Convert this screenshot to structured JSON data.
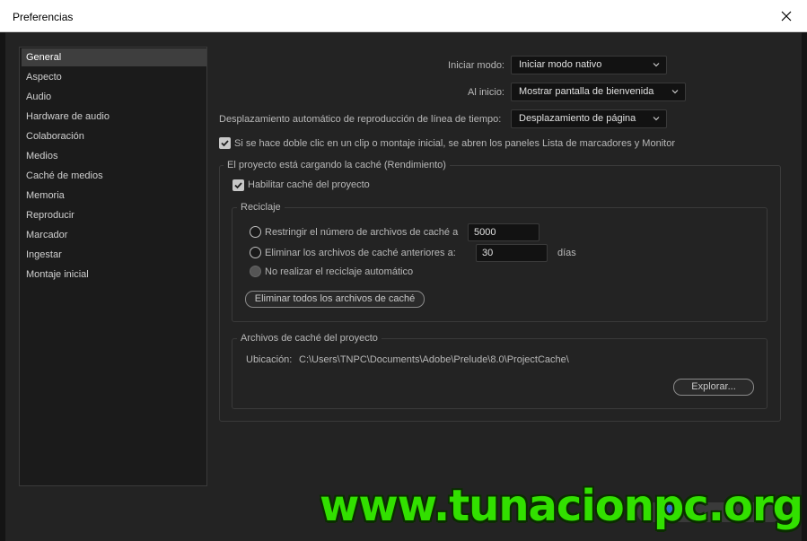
{
  "window": {
    "title": "Preferencias"
  },
  "sidebar": {
    "items": [
      {
        "label": "General",
        "selected": true
      },
      {
        "label": "Aspecto"
      },
      {
        "label": "Audio"
      },
      {
        "label": "Hardware de audio"
      },
      {
        "label": "Colaboración"
      },
      {
        "label": "Medios"
      },
      {
        "label": "Caché de medios"
      },
      {
        "label": "Memoria"
      },
      {
        "label": "Reproducir"
      },
      {
        "label": "Marcador"
      },
      {
        "label": "Ingestar"
      },
      {
        "label": "Montaje inicial"
      }
    ]
  },
  "general": {
    "startup_mode_label": "Iniciar modo:",
    "startup_mode_value": "Iniciar modo nativo",
    "on_start_label": "Al inicio:",
    "on_start_value": "Mostrar pantalla de bienvenida",
    "autoscroll_label": "Desplazamiento automático de reproducción de línea de tiempo:",
    "autoscroll_value": "Desplazamiento de página",
    "doubleclick_label": "Si se hace doble clic en un clip o montaje inicial, se abren los paneles Lista de marcadores y Monitor",
    "doubleclick_checked": true
  },
  "cache_group": {
    "title": "El proyecto está cargando la caché (Rendimiento)",
    "enable_label": "Habilitar caché del proyecto",
    "enable_checked": true,
    "recycle": {
      "title": "Reciclaje",
      "limit_files_label": "Restringir el número de archivos de caché a",
      "limit_files_value": "5000",
      "older_than_label": "Eliminar los archivos de caché anteriores a:",
      "older_than_value": "30",
      "days_label": "días",
      "no_recycle_label": "No realizar el reciclaje automático",
      "delete_all_button": "Eliminar todos los archivos de caché"
    },
    "files": {
      "title": "Archivos de caché del proyecto",
      "location_label": "Ubicación:",
      "location_value": "C:\\Users\\TNPC\\Documents\\Adobe\\Prelude\\8.0\\ProjectCache\\",
      "browse_button": "Explorar..."
    }
  },
  "watermark": {
    "text": "www.tunacionpc.org"
  },
  "colors": {
    "watermark": "#32e000",
    "selected": "#3e3e3e",
    "background": "#232323"
  }
}
